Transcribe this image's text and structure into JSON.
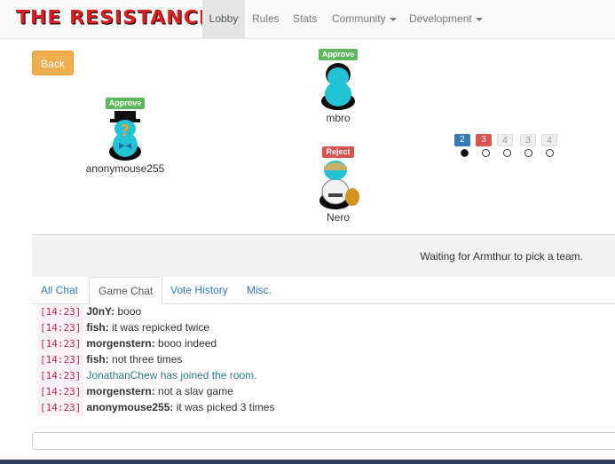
{
  "navbar": {
    "brand": "THE RESISTANCE",
    "items": [
      {
        "label": "Lobby",
        "active": true
      },
      {
        "label": "Rules"
      },
      {
        "label": "Stats"
      },
      {
        "label": "Community"
      },
      {
        "label": "Development"
      }
    ]
  },
  "back_label": "Back",
  "players": [
    {
      "name": "mbro",
      "vote": "Approve"
    },
    {
      "name": "anonymouse255",
      "vote": "Approve"
    },
    {
      "name": "Nero",
      "vote": "Reject"
    }
  ],
  "missions": {
    "boxes": [
      "2",
      "3",
      "4",
      "3",
      "4"
    ],
    "box_colors": [
      "#337ab7",
      "#d9534f",
      "grey",
      "grey",
      "grey"
    ],
    "vote_track_filled": 1
  },
  "status": "Waiting for Armthur to pick a team.",
  "tabs": [
    "All Chat",
    "Game Chat",
    "Vote History",
    "Misc."
  ],
  "active_tab": "Game Chat",
  "chat": [
    {
      "time": "[14:23]",
      "user": "J0nY:",
      "text": " booo"
    },
    {
      "time": "[14:23]",
      "user": "fish:",
      "text": " it was repicked twice"
    },
    {
      "time": "[14:23]",
      "user": "morgenstern:",
      "text": " booo indeed"
    },
    {
      "time": "[14:23]",
      "user": "fish:",
      "text": " not three times"
    },
    {
      "time": "[14:23]",
      "user": "",
      "text": "JonathanChew has joined the room.",
      "system": true
    },
    {
      "time": "[14:23]",
      "user": "morgenstern:",
      "text": " not a slav game"
    },
    {
      "time": "[14:23]",
      "user": "anonymouse255:",
      "text": " it was picked 3 times"
    }
  ]
}
